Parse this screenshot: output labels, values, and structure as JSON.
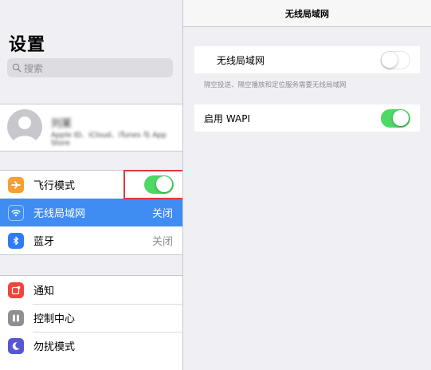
{
  "sidebar": {
    "title": "设置",
    "search_placeholder": "搜索",
    "profile": {
      "name": "刘某",
      "subtitle": "Apple ID、iCloud、iTunes 与 App Store"
    },
    "airplane": {
      "label": "飞行模式",
      "toggle": "on",
      "icon": "airplane-icon"
    },
    "wifi": {
      "label": "无线局域网",
      "value": "关闭",
      "icon": "wifi-icon",
      "selected": true
    },
    "bluetooth": {
      "label": "蓝牙",
      "value": "关闭",
      "icon": "bluetooth-icon"
    },
    "notifications": {
      "label": "通知",
      "icon": "notifications-icon"
    },
    "control_center": {
      "label": "控制中心",
      "icon": "control-center-icon"
    },
    "dnd": {
      "label": "勿扰模式",
      "icon": "moon-icon"
    }
  },
  "detail": {
    "nav_title": "无线局域网",
    "wifi_row": {
      "label": "无线局域网",
      "toggle": "off"
    },
    "footnote": "隔空投送、隔空播放和定位服务需要无线局域网",
    "wapi_row": {
      "label": "启用 WAPI",
      "toggle": "on"
    }
  },
  "colors": {
    "accent": "#3f8cf2",
    "toggle_on": "#4cd964",
    "airplane_icon": "#f5a033",
    "wifi_icon": "#3f8cf2",
    "bluetooth_icon": "#2f7bf5",
    "notifications_icon": "#f0453b",
    "control_center_icon": "#8e8e93",
    "dnd_icon": "#5856d6",
    "highlight": "#e0383e"
  }
}
